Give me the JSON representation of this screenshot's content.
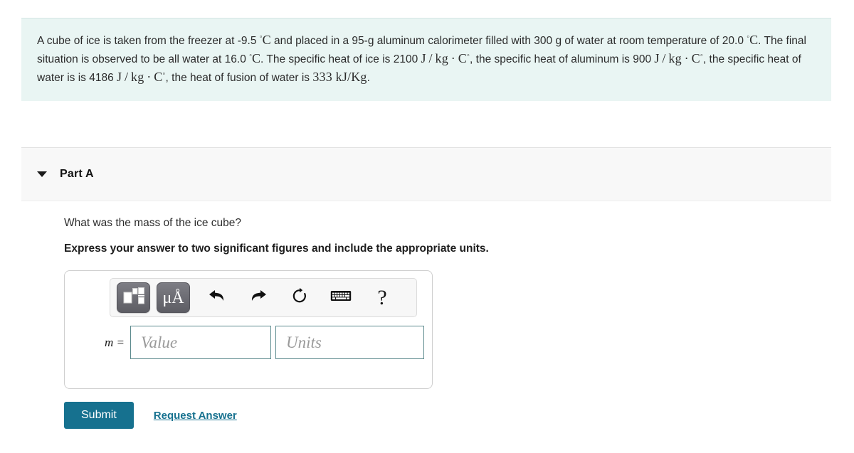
{
  "problem": {
    "segments": [
      {
        "t": "text",
        "v": "A cube of ice is taken from the freezer at -9.5 "
      },
      {
        "t": "math",
        "v": "°C"
      },
      {
        "t": "text",
        "v": " and placed in a 95-g aluminum calorimeter filled with 300  g of water at room temperature of 20.0 "
      },
      {
        "t": "math",
        "v": "°C"
      },
      {
        "t": "text",
        "v": ". The final situation is observed to be all water at 16.0 "
      },
      {
        "t": "math",
        "v": "°C"
      },
      {
        "t": "text",
        "v": ". The specific heat of ice is 2100 "
      },
      {
        "t": "math",
        "v": "J/kg · C°"
      },
      {
        "t": "text",
        "v": ", the specific heat of aluminum is 900 "
      },
      {
        "t": "math",
        "v": "J/kg · C°"
      },
      {
        "t": "text",
        "v": ", the specific heat of water is is 4186 "
      },
      {
        "t": "math",
        "v": "J/kg · C°"
      },
      {
        "t": "text",
        "v": ", the heat of fusion of water is "
      },
      {
        "t": "math",
        "v": "333 kJ/Kg"
      },
      {
        "t": "text",
        "v": "."
      }
    ],
    "full_text": "A cube of ice is taken from the freezer at -9.5 °C and placed in a 95-g aluminum calorimeter filled with 300  g of water at room temperature of 20.0 °C. The final situation is observed to be all water at 16.0 °C. The specific heat of ice is 2100 J/kg · C°, the specific heat of aluminum is 900 J/kg · C°, the specific heat of water is is 4186 J/kg · C°, the heat of fusion of water is 333 kJ/Kg.",
    "background_color": "#e9f5f3"
  },
  "part": {
    "title": "Part A",
    "expanded": true,
    "caret_icon": "chevron-down-icon",
    "background_color": "#f8f8f8"
  },
  "question": {
    "prompt": "What was the mass of the ice cube?",
    "instruction": "Express your answer to two significant figures and include the appropriate units."
  },
  "toolbar": {
    "buttons": [
      {
        "name": "math-template-button",
        "icon": "math-template-icon",
        "label": ""
      },
      {
        "name": "units-button",
        "icon": "micro-angstrom-icon",
        "label": "μÅ"
      },
      {
        "name": "undo-button",
        "icon": "undo-arrow-icon",
        "label": "↶"
      },
      {
        "name": "redo-button",
        "icon": "redo-arrow-icon",
        "label": "↷"
      },
      {
        "name": "reset-button",
        "icon": "refresh-circle-icon",
        "label": "⟳"
      },
      {
        "name": "keyboard-button",
        "icon": "keyboard-icon",
        "label": "⌨"
      },
      {
        "name": "help-button",
        "icon": "question-mark-icon",
        "label": "?"
      }
    ]
  },
  "answer": {
    "variable_label": "m =",
    "value_placeholder": "Value",
    "value": "",
    "units_placeholder": "Units",
    "units": "",
    "field_border_color": "#5b8a8d"
  },
  "actions": {
    "submit_label": "Submit",
    "request_answer_label": "Request Answer",
    "accent_color": "#16718f"
  }
}
